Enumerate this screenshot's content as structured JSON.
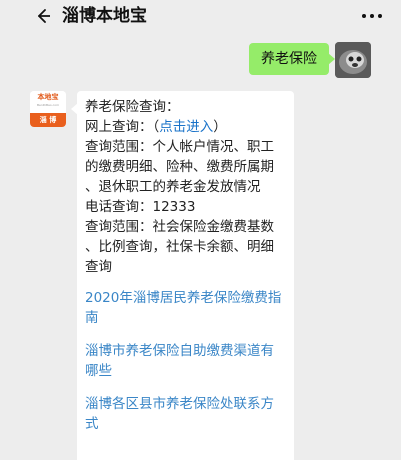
{
  "header": {
    "title": "淄博本地宝",
    "back_icon": "back-arrow-icon",
    "more_icon": "more-dots-icon"
  },
  "chat": {
    "outgoing": {
      "text": "养老保险"
    },
    "incoming": {
      "lines": [
        "养老保险查询：",
        "网上查询：（",
        "点击进入",
        "）",
        "查询范围：个人帐户情况、职工",
        "的缴费明细、险种、缴费所属期",
        "、退休职工的养老金发放情况",
        "电话查询：12333",
        "查询范围：社会保险金缴费基数",
        "、比例查询，社保卡余额、明细",
        "查询"
      ],
      "articles": [
        {
          "line1": "2020年淄博居民养老保险缴费指",
          "line2": "南"
        },
        {
          "line1": "淄博市养老保险自助缴费渠道有",
          "line2": "哪些"
        },
        {
          "line1": "淄博各区县市养老保险处联系方",
          "line2": "式"
        }
      ]
    },
    "bot_avatar": {
      "top": "本地宝",
      "sub": "BenDiBao.com",
      "bottom": "淄 博"
    }
  },
  "colors": {
    "background": "#ededed",
    "outgoing_bubble": "#95ec69",
    "link": "#1a73c9",
    "avatar_orange": "#e95f1d"
  }
}
